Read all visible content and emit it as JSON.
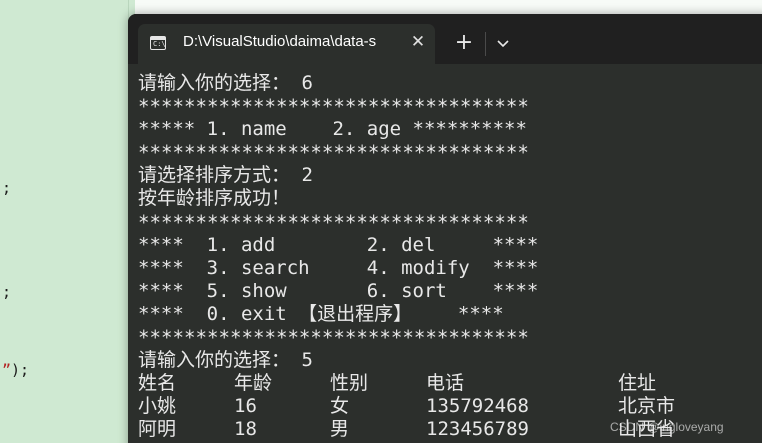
{
  "background_editor": {
    "fragments": [
      ";",
      ";",
      "”);"
    ]
  },
  "window": {
    "tab_title": "D:\\VisualStudio\\daima\\data-s",
    "tab_icon": "terminal-icon",
    "tab_icon_glyph": "C:\\",
    "close_glyph": "✕",
    "new_tab_glyph": "+",
    "dropdown_icon": "chevron-down-icon"
  },
  "console": {
    "lines": [
      "请输入你的选择： 6",
      "**********************************",
      "***** 1. name    2. age **********",
      "**********************************",
      "请选择排序方式： 2",
      "按年龄排序成功！",
      "**********************************",
      "****  1. add        2. del     ****",
      "****  3. search     4. modify  ****",
      "****  5. show       6. sort    ****",
      "****  0. exit 【退出程序】    ****",
      "**********************************",
      "请输入你的选择： 5"
    ],
    "table": {
      "headers": [
        "姓名",
        "年龄",
        "性别",
        "电话",
        "住址"
      ],
      "rows": [
        [
          "小姚",
          "16",
          "女",
          "135792468",
          "北京市"
        ],
        [
          "阿明",
          "18",
          "男",
          "123456789",
          "山西省"
        ]
      ]
    }
  },
  "watermark": "CSDN @ingloveyang",
  "colors": {
    "terminal_bg": "#2c2f2c",
    "titlebar_bg": "#202020",
    "text": "#e8e8e8",
    "editor_bg": "#cfe9d2"
  }
}
